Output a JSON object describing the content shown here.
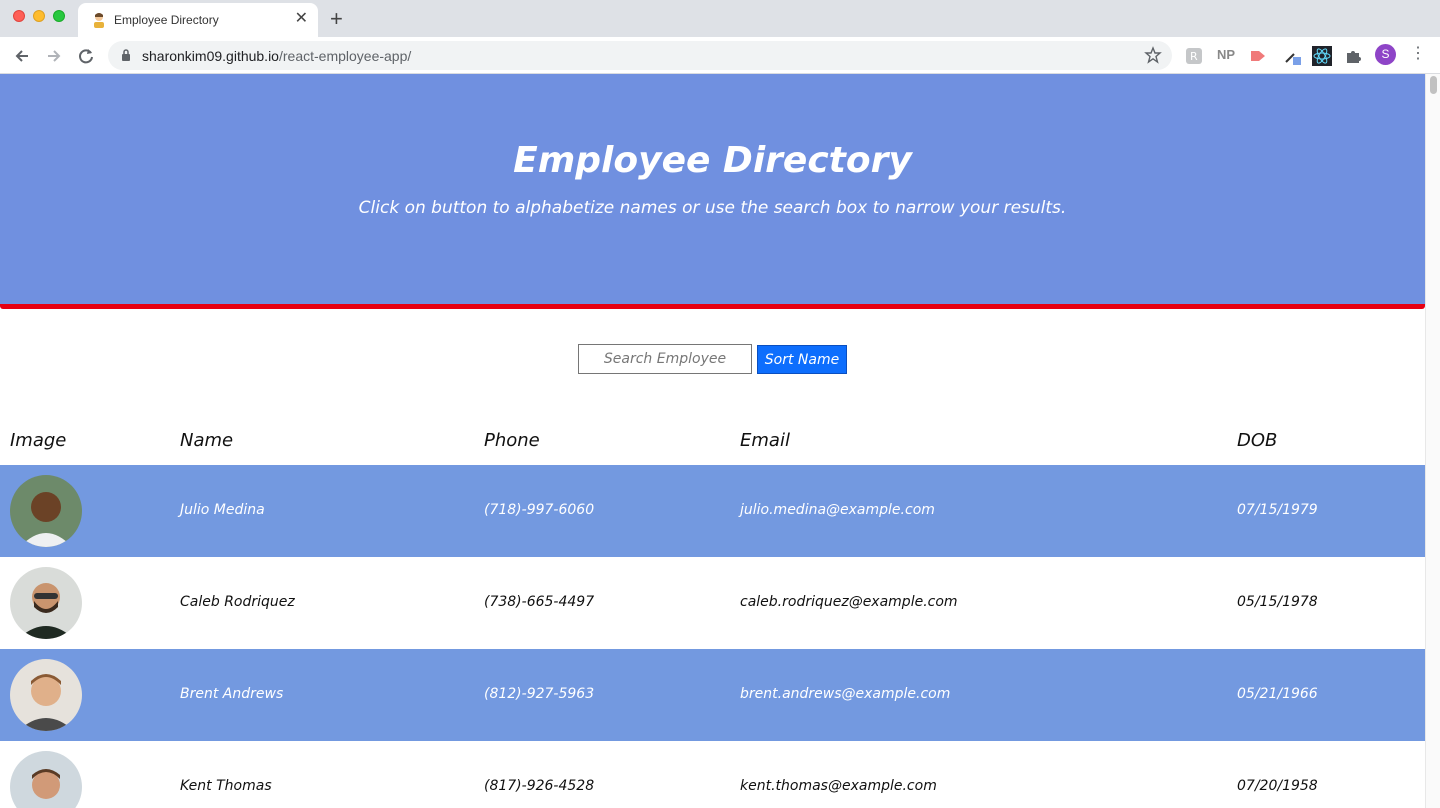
{
  "browser": {
    "tab_title": "Employee Directory",
    "url_host": "sharonkim09.github.io",
    "url_path": "/react-employee-app/",
    "ext_np_label": "NP",
    "profile_initial": "S"
  },
  "hero": {
    "title": "Employee Directory",
    "subtitle": "Click on button to alphabetize names or use the search box to narrow your results."
  },
  "controls": {
    "search_placeholder": "Search Employee",
    "sort_label": "Sort Name"
  },
  "table": {
    "headers": {
      "image": "Image",
      "name": "Name",
      "phone": "Phone",
      "email": "Email",
      "dob": "DOB"
    },
    "rows": [
      {
        "name": "Julio Medina",
        "phone": "(718)-997-6060",
        "email": "julio.medina@example.com",
        "dob": "07/15/1979"
      },
      {
        "name": "Caleb Rodriquez",
        "phone": "(738)-665-4497",
        "email": "caleb.rodriquez@example.com",
        "dob": "05/15/1978"
      },
      {
        "name": "Brent Andrews",
        "phone": "(812)-927-5963",
        "email": "brent.andrews@example.com",
        "dob": "05/21/1966"
      },
      {
        "name": "Kent Thomas",
        "phone": "(817)-926-4528",
        "email": "kent.thomas@example.com",
        "dob": "07/20/1958"
      }
    ]
  },
  "colors": {
    "hero_bg": "#7090e0",
    "hero_border": "#e60012",
    "row_stripe": "#7399e0",
    "sort_button": "#0d6efd"
  }
}
